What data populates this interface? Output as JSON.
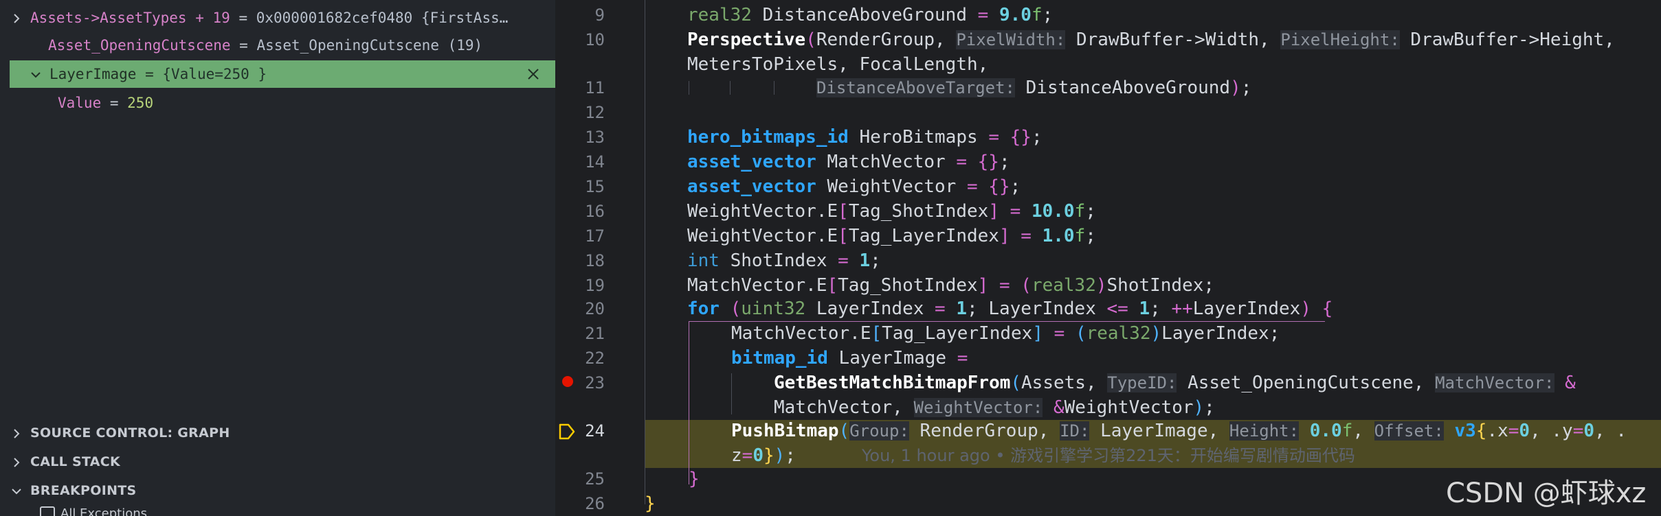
{
  "variables": {
    "row1_name": "Assets->AssetTypes + 19",
    "row1_eq": " = ",
    "row1_value": "0x000001682cef0480 {FirstAss…",
    "row2_name": "Asset_OpeningCutscene",
    "row2_eq": " = ",
    "row2_value": "Asset_OpeningCutscene (19)",
    "row3_name": "LayerImage",
    "row3_eq": " = ",
    "row3_value": "{Value=250 }",
    "row4_name": "Value",
    "row4_eq": " = ",
    "row4_value": "250"
  },
  "sections": {
    "source_control": "SOURCE CONTROL: GRAPH",
    "call_stack": "CALL STACK",
    "breakpoints": "BREAKPOINTS",
    "all_exceptions": "All Exceptions"
  },
  "lines": {
    "n9": "9",
    "n10": "10",
    "n11": "11",
    "n12": "12",
    "n13": "13",
    "n14": "14",
    "n15": "15",
    "n16": "16",
    "n17": "17",
    "n18": "18",
    "n19": "19",
    "n20": "20",
    "n21": "21",
    "n22": "22",
    "n23": "23",
    "n24": "24",
    "n25": "25",
    "n26": "26"
  },
  "code": {
    "l9_a": "real32",
    "l9_b": " DistanceAboveGround ",
    "l9_c": "=",
    "l9_d": " 9.0",
    "l9_e": "f",
    "l9_f": ";",
    "l10_fn": "Perspective",
    "l10_b": "(",
    "l10_c": "RenderGroup, ",
    "l10_h1": "PixelWidth:",
    "l10_d": " DrawBuffer->Width, ",
    "l10_h2": "PixelHeight:",
    "l10_e": " DrawBuffer->Height,",
    "l10w": "MetersToPixels, FocalLength,",
    "l11_h": "DistanceAboveTarget:",
    "l11_a": " DistanceAboveGround",
    "l11_b": ")",
    "l11_c": ";",
    "l13_t": "hero_bitmaps_id",
    "l13_a": " HeroBitmaps ",
    "l13_o": "=",
    "l13_b": " {}",
    "l13_c": ";",
    "l14_t": "asset_vector",
    "l14_a": " MatchVector ",
    "l14_o": "=",
    "l14_b": " {}",
    "l14_c": ";",
    "l15_t": "asset_vector",
    "l15_a": " WeightVector ",
    "l15_o": "=",
    "l15_b": " {}",
    "l15_c": ";",
    "l16_a": "WeightVector.E",
    "l16_b": "[",
    "l16_c": "Tag_ShotIndex",
    "l16_d": "]",
    "l16_o": " = ",
    "l16_n": "10.0",
    "l16_f": "f",
    "l16_e": ";",
    "l17_a": "WeightVector.E",
    "l17_b": "[",
    "l17_c": "Tag_LayerIndex",
    "l17_d": "]",
    "l17_o": " = ",
    "l17_n": "1.0",
    "l17_f": "f",
    "l17_e": ";",
    "l18_t": "int",
    "l18_a": " ShotIndex ",
    "l18_o": "=",
    "l18_n": " 1",
    "l18_e": ";",
    "l19_a": "MatchVector.E",
    "l19_b": "[",
    "l19_c": "Tag_ShotIndex",
    "l19_d": "]",
    "l19_o": " = ",
    "l19_p": "(",
    "l19_t": "real32",
    "l19_q": ")",
    "l19_e": "ShotIndex;",
    "l20_k": "for",
    "l20_p": " (",
    "l20_t": "uint32",
    "l20_a": " LayerIndex ",
    "l20_o": "=",
    "l20_n": " 1",
    "l20_b": "; LayerIndex ",
    "l20_o2": "<=",
    "l20_n2": " 1",
    "l20_c": "; ",
    "l20_o3": "++",
    "l20_d": "LayerIndex",
    "l20_q": ")",
    "l20_r": " {",
    "l21_a": "MatchVector.E",
    "l21_b": "[",
    "l21_c": "Tag_LayerIndex",
    "l21_d": "]",
    "l21_o": " = ",
    "l21_p": "(",
    "l21_t": "real32",
    "l21_q": ")",
    "l21_e": "LayerIndex;",
    "l22_t": "bitmap_id",
    "l22_a": " LayerImage ",
    "l22_o": "=",
    "l23_fn": "GetBestMatchBitmapFrom",
    "l23_p": "(",
    "l23_a": "Assets, ",
    "l23_h1": "TypeID:",
    "l23_b": " Asset_OpeningCutscene, ",
    "l23_h2": "MatchVector:",
    "l23_c": " &",
    "l23w_a": "MatchVector, ",
    "l23w_h": "WeightVector:",
    "l23w_b": " &",
    "l23w_c": "WeightVector",
    "l23w_q": ")",
    "l23w_e": ";",
    "l24_fn": "PushBitmap",
    "l24_p": "(",
    "l24_h1": "Group:",
    "l24_a": " RenderGroup, ",
    "l24_h2": "ID:",
    "l24_b": " LayerImage, ",
    "l24_h3": "Height:",
    "l24_n": " 0.0",
    "l24_f": "f",
    "l24_c": ", ",
    "l24_h4": "Offset:",
    "l24_v": " v3",
    "l24_br": "{",
    "l24_d": ".x",
    "l24_o": "=",
    "l24_n2": "0",
    "l24_e": ", .y",
    "l24_o2": "=",
    "l24_n3": "0",
    "l24_g": ", .",
    "l24w_a": "z",
    "l24w_o": "=",
    "l24w_n": "0",
    "l24w_br": "}",
    "l24w_q": ")",
    "l24w_e": ";",
    "blame": "You, 1 hour ago • 游戏引擎学习第221天：开始编写剧情动画代码",
    "l25": "}",
    "l26": "}"
  },
  "watermark": "CSDN @虾球xz",
  "colors": {
    "selected_row": "#6cab72",
    "breakpoint": "#e51400",
    "current_line": "#4d4a23"
  }
}
